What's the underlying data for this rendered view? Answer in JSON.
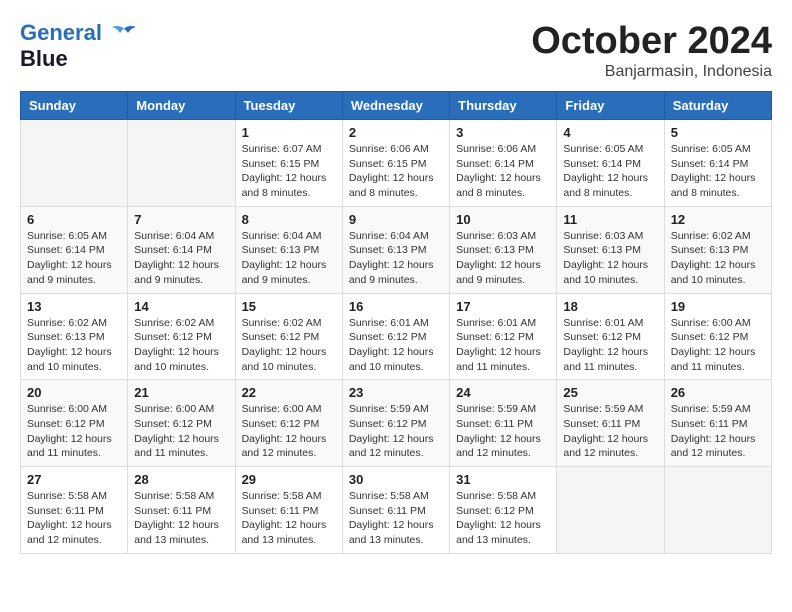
{
  "logo": {
    "line1": "General",
    "line2": "Blue"
  },
  "header": {
    "month": "October 2024",
    "location": "Banjarmasin, Indonesia"
  },
  "days_of_week": [
    "Sunday",
    "Monday",
    "Tuesday",
    "Wednesday",
    "Thursday",
    "Friday",
    "Saturday"
  ],
  "weeks": [
    [
      {
        "day": "",
        "info": ""
      },
      {
        "day": "",
        "info": ""
      },
      {
        "day": "1",
        "info": "Sunrise: 6:07 AM\nSunset: 6:15 PM\nDaylight: 12 hours and 8 minutes."
      },
      {
        "day": "2",
        "info": "Sunrise: 6:06 AM\nSunset: 6:15 PM\nDaylight: 12 hours and 8 minutes."
      },
      {
        "day": "3",
        "info": "Sunrise: 6:06 AM\nSunset: 6:14 PM\nDaylight: 12 hours and 8 minutes."
      },
      {
        "day": "4",
        "info": "Sunrise: 6:05 AM\nSunset: 6:14 PM\nDaylight: 12 hours and 8 minutes."
      },
      {
        "day": "5",
        "info": "Sunrise: 6:05 AM\nSunset: 6:14 PM\nDaylight: 12 hours and 8 minutes."
      }
    ],
    [
      {
        "day": "6",
        "info": "Sunrise: 6:05 AM\nSunset: 6:14 PM\nDaylight: 12 hours and 9 minutes."
      },
      {
        "day": "7",
        "info": "Sunrise: 6:04 AM\nSunset: 6:14 PM\nDaylight: 12 hours and 9 minutes."
      },
      {
        "day": "8",
        "info": "Sunrise: 6:04 AM\nSunset: 6:13 PM\nDaylight: 12 hours and 9 minutes."
      },
      {
        "day": "9",
        "info": "Sunrise: 6:04 AM\nSunset: 6:13 PM\nDaylight: 12 hours and 9 minutes."
      },
      {
        "day": "10",
        "info": "Sunrise: 6:03 AM\nSunset: 6:13 PM\nDaylight: 12 hours and 9 minutes."
      },
      {
        "day": "11",
        "info": "Sunrise: 6:03 AM\nSunset: 6:13 PM\nDaylight: 12 hours and 10 minutes."
      },
      {
        "day": "12",
        "info": "Sunrise: 6:02 AM\nSunset: 6:13 PM\nDaylight: 12 hours and 10 minutes."
      }
    ],
    [
      {
        "day": "13",
        "info": "Sunrise: 6:02 AM\nSunset: 6:13 PM\nDaylight: 12 hours and 10 minutes."
      },
      {
        "day": "14",
        "info": "Sunrise: 6:02 AM\nSunset: 6:12 PM\nDaylight: 12 hours and 10 minutes."
      },
      {
        "day": "15",
        "info": "Sunrise: 6:02 AM\nSunset: 6:12 PM\nDaylight: 12 hours and 10 minutes."
      },
      {
        "day": "16",
        "info": "Sunrise: 6:01 AM\nSunset: 6:12 PM\nDaylight: 12 hours and 10 minutes."
      },
      {
        "day": "17",
        "info": "Sunrise: 6:01 AM\nSunset: 6:12 PM\nDaylight: 12 hours and 11 minutes."
      },
      {
        "day": "18",
        "info": "Sunrise: 6:01 AM\nSunset: 6:12 PM\nDaylight: 12 hours and 11 minutes."
      },
      {
        "day": "19",
        "info": "Sunrise: 6:00 AM\nSunset: 6:12 PM\nDaylight: 12 hours and 11 minutes."
      }
    ],
    [
      {
        "day": "20",
        "info": "Sunrise: 6:00 AM\nSunset: 6:12 PM\nDaylight: 12 hours and 11 minutes."
      },
      {
        "day": "21",
        "info": "Sunrise: 6:00 AM\nSunset: 6:12 PM\nDaylight: 12 hours and 11 minutes."
      },
      {
        "day": "22",
        "info": "Sunrise: 6:00 AM\nSunset: 6:12 PM\nDaylight: 12 hours and 12 minutes."
      },
      {
        "day": "23",
        "info": "Sunrise: 5:59 AM\nSunset: 6:12 PM\nDaylight: 12 hours and 12 minutes."
      },
      {
        "day": "24",
        "info": "Sunrise: 5:59 AM\nSunset: 6:11 PM\nDaylight: 12 hours and 12 minutes."
      },
      {
        "day": "25",
        "info": "Sunrise: 5:59 AM\nSunset: 6:11 PM\nDaylight: 12 hours and 12 minutes."
      },
      {
        "day": "26",
        "info": "Sunrise: 5:59 AM\nSunset: 6:11 PM\nDaylight: 12 hours and 12 minutes."
      }
    ],
    [
      {
        "day": "27",
        "info": "Sunrise: 5:58 AM\nSunset: 6:11 PM\nDaylight: 12 hours and 12 minutes."
      },
      {
        "day": "28",
        "info": "Sunrise: 5:58 AM\nSunset: 6:11 PM\nDaylight: 12 hours and 13 minutes."
      },
      {
        "day": "29",
        "info": "Sunrise: 5:58 AM\nSunset: 6:11 PM\nDaylight: 12 hours and 13 minutes."
      },
      {
        "day": "30",
        "info": "Sunrise: 5:58 AM\nSunset: 6:11 PM\nDaylight: 12 hours and 13 minutes."
      },
      {
        "day": "31",
        "info": "Sunrise: 5:58 AM\nSunset: 6:12 PM\nDaylight: 12 hours and 13 minutes."
      },
      {
        "day": "",
        "info": ""
      },
      {
        "day": "",
        "info": ""
      }
    ]
  ]
}
